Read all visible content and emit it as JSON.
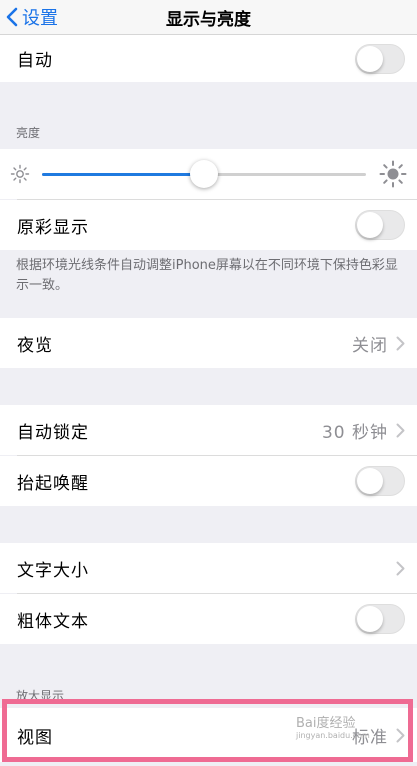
{
  "nav": {
    "back_label": "设置",
    "title": "显示与亮度"
  },
  "rows": {
    "auto": {
      "label": "自动",
      "on": false
    },
    "true_tone": {
      "label": "原彩显示",
      "on": false
    },
    "night_shift": {
      "label": "夜览",
      "value": "关闭"
    },
    "auto_lock": {
      "label": "自动锁定",
      "value": "30 秒钟"
    },
    "raise_to_wake": {
      "label": "抬起唤醒",
      "on": false
    },
    "text_size": {
      "label": "文字大小"
    },
    "bold_text": {
      "label": "粗体文本",
      "on": false
    },
    "view": {
      "label": "视图",
      "value": "标准"
    }
  },
  "brightness": {
    "header": "亮度",
    "level": 0.5
  },
  "true_tone_footer": "根据环境光线条件自动调整iPhone屏幕以在不同环境下保持色彩显示一致。",
  "zoom_header": "放大显示",
  "watermark": {
    "text": "Bai度经验",
    "url": "jingyan.baidu.com"
  },
  "colors": {
    "accent": "#1f7ae0",
    "highlight": "#ef6b93",
    "background": "#efeff4"
  }
}
